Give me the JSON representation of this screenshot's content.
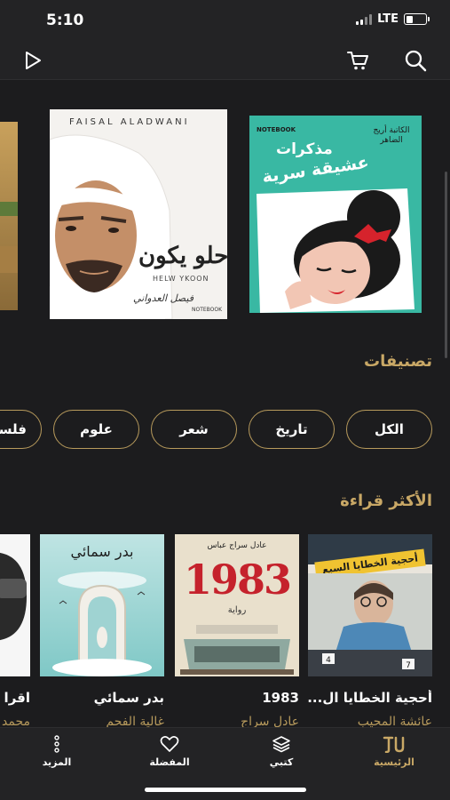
{
  "status_bar": {
    "time": "5:10",
    "network": "LTE",
    "battery_level": 0.35
  },
  "top_bar": {
    "icons": [
      "play-icon",
      "cart-icon",
      "search-icon"
    ]
  },
  "featured": {
    "books": [
      {
        "title_line1": "مذكرات",
        "title_line2": "عشيقة سرية",
        "author_tag": "الكاتبة أريج الضاهر",
        "publisher": "NOTEBOOK"
      },
      {
        "top_text": "FAISAL ALADWANI",
        "title_ar": "حلو يكون",
        "title_en": "HELW YKOON",
        "signature": "فيصل العدواني",
        "publisher": "NOTEBOOK"
      }
    ]
  },
  "categories": {
    "title": "تصنيفات",
    "chips": [
      "الكل",
      "تاريخ",
      "شعر",
      "علوم",
      "فلسفة"
    ]
  },
  "most_read": {
    "title": "الأكثر قراءة",
    "books": [
      {
        "title": "أحجية الخطايا ال...",
        "author": "عائشة المحيب",
        "cover_text": "أحجية الخطايا السبع"
      },
      {
        "title": "1983",
        "author": "عادل سراج",
        "cover_number": "1983",
        "cover_sub": "رواية",
        "cover_author": "عادل سراج عباس"
      },
      {
        "title": "بدر سمائي",
        "author": "غالية الفحم",
        "cover_title": "بدر سمائي"
      },
      {
        "title": "اقرا مع",
        "author": "محمد"
      }
    ]
  },
  "tab_bar": {
    "tabs": [
      {
        "label": "الرئيسية",
        "icon": "home-logo-icon",
        "active": true
      },
      {
        "label": "كتبي",
        "icon": "layers-icon",
        "active": false
      },
      {
        "label": "المفضلة",
        "icon": "heart-icon",
        "active": false
      },
      {
        "label": "المزيد",
        "icon": "more-dots-icon",
        "active": false
      }
    ]
  },
  "colors": {
    "accent": "#c9a866",
    "background": "#1c1c1e",
    "bar": "#232325"
  }
}
